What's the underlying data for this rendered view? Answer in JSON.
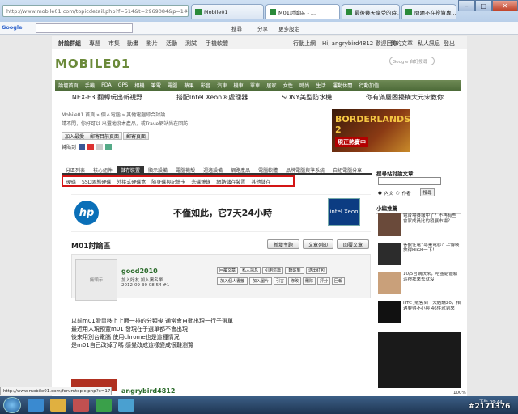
{
  "browser": {
    "address": "http://www.mobile01.com/topicdetail.php?f=514&t=2969084&p=1#38825452",
    "tabs": [
      "Mobile01",
      "M01討論區 - ...",
      "最後幾天享受的時...",
      "問題不在投資專..."
    ],
    "window_buttons": [
      "–",
      "□",
      "✕"
    ]
  },
  "toolbar": {
    "google_label": "Google",
    "items": [
      "搜尋",
      "分享",
      "更多設定"
    ]
  },
  "site_nav": {
    "items": [
      "討論群組",
      "專題",
      "市集",
      "動畫",
      "影片",
      "活動",
      "測試",
      "手機軟體"
    ],
    "right": [
      "行動上網",
      "Hi, angrybird4812 歡迎回來",
      "我的文章",
      "私人訊息",
      "登出"
    ]
  },
  "logo": "MOBILE01",
  "site_search_placeholder": "Google 自訂搜尋",
  "categories": [
    "論壇首頁",
    "手機",
    "PDA",
    "GPS",
    "相機",
    "筆電",
    "電腦",
    "蘋果",
    "影音",
    "汽車",
    "機車",
    "單車",
    "居家",
    "女性",
    "時尚",
    "生活",
    "運動休閒",
    "行動加值"
  ],
  "promo": [
    "NEX-F3 翻轉玩出新視野",
    "搭配Intel Xeon®處理器",
    "SONY美型防水機",
    "你有滿屋困擾構大元宋教你"
  ],
  "breadcrumb": "Mobile01 首頁 » 個人電腦 » 其他電腦綜合討論",
  "notice": "請不問，你好可以 出還地沒本產品，或Trave網站尚在回訪",
  "action_buttons": [
    "加入最愛",
    "郵寄目前頁面",
    "郵寄頁面"
  ],
  "share_label": "轉貼到",
  "ad": {
    "title": "BORDERLANDS 2",
    "badge": "現正熱賣中"
  },
  "forum_tabs": [
    "分區列表",
    "核心組件",
    "儲存裝置",
    "顯示設備",
    "電腦機殼",
    "週邊設備",
    "網路產品",
    "電腦軟體",
    "品牌電腦與準系統",
    "自組電腦分享"
  ],
  "forum_tab_selected": 2,
  "sub_tabs": [
    "硬碟",
    "SSD固態硬碟",
    "外接式硬碟盒",
    "隨身碟與記憶卡",
    "光碟燒錄",
    "網路儲存裝置",
    "其他儲存"
  ],
  "hp_banner": {
    "logo": "hp",
    "slogan": "不僅如此，它7天24小時",
    "intel": "intel Xeon"
  },
  "forum_title": "M01討論區",
  "forum_buttons": [
    "新增主題",
    "文章列印",
    "回覆文章"
  ],
  "post": {
    "avatar_text": "無頭示",
    "username": "good2010",
    "meta": "加入好友  加入黑名單",
    "date": "2012-09-30 08:54  #1",
    "buttons_row1": [
      "回覆文章",
      "私人訊息",
      "引用這篇",
      "轉貼到",
      "送出紅包"
    ],
    "buttons_row2": [
      "加入個人書籤",
      "加入圖片",
      "引言",
      "修改",
      "刪除",
      "評分",
      "回報"
    ],
    "content": [
      "以前m01滑鼠移上上面一排的分類後 通常會自動出現一行子選單",
      "最近用人現預覽m01 發現在子選單都不會出現",
      "後來用別台電腦 使用chrome也是這種情況",
      "是m01自己改掉了嗎 感覺改成這樣變成很難瀏覽"
    ]
  },
  "post2": {
    "username": "angrybird4812"
  },
  "right_col": {
    "search_title": "搜尋站討論文章",
    "radio": [
      "內文",
      "作者"
    ],
    "search_button": "搜尋",
    "ads_title": "小編推薦",
    "items": [
      "電台場賽報中了？不再有些會家成員比的發展市場？",
      "客觀性電Y專業電影？上傳裝放得HIGH一下！",
      "10/5官網快來，哈金給體驗這禮拜來去就沒",
      "HTC J販售到一大結論20，相遇要得不小與 46件就到來"
    ]
  },
  "status_text": "http://www.mobile01.com/forumtopic.php?c=17&s=6",
  "zoom": "100%",
  "clock": "下午 09:44",
  "watermark": "#2171376",
  "colors": {
    "nav_green": "#4d6b39",
    "logo_green": "#6b8a3a",
    "red_outline": "#d31515",
    "hp_blue": "#0a6fb8"
  }
}
